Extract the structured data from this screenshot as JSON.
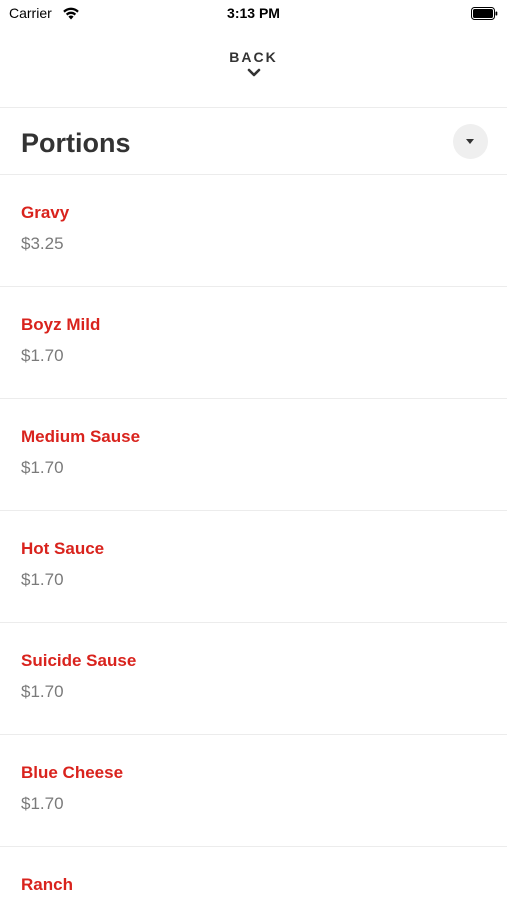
{
  "status_bar": {
    "carrier": "Carrier",
    "time": "3:13 PM"
  },
  "nav": {
    "back_label": "BACK"
  },
  "section": {
    "title": "Portions"
  },
  "colors": {
    "accent": "#d9231d",
    "price": "#7a7a7a",
    "title": "#333333",
    "divider": "#ececec"
  },
  "items": [
    {
      "name": "Gravy",
      "price": "$3.25"
    },
    {
      "name": "Boyz Mild",
      "price": "$1.70"
    },
    {
      "name": "Medium Sause",
      "price": "$1.70"
    },
    {
      "name": "Hot Sauce",
      "price": "$1.70"
    },
    {
      "name": "Suicide Sause",
      "price": "$1.70"
    },
    {
      "name": "Blue Cheese",
      "price": "$1.70"
    },
    {
      "name": "Ranch",
      "price": ""
    }
  ]
}
